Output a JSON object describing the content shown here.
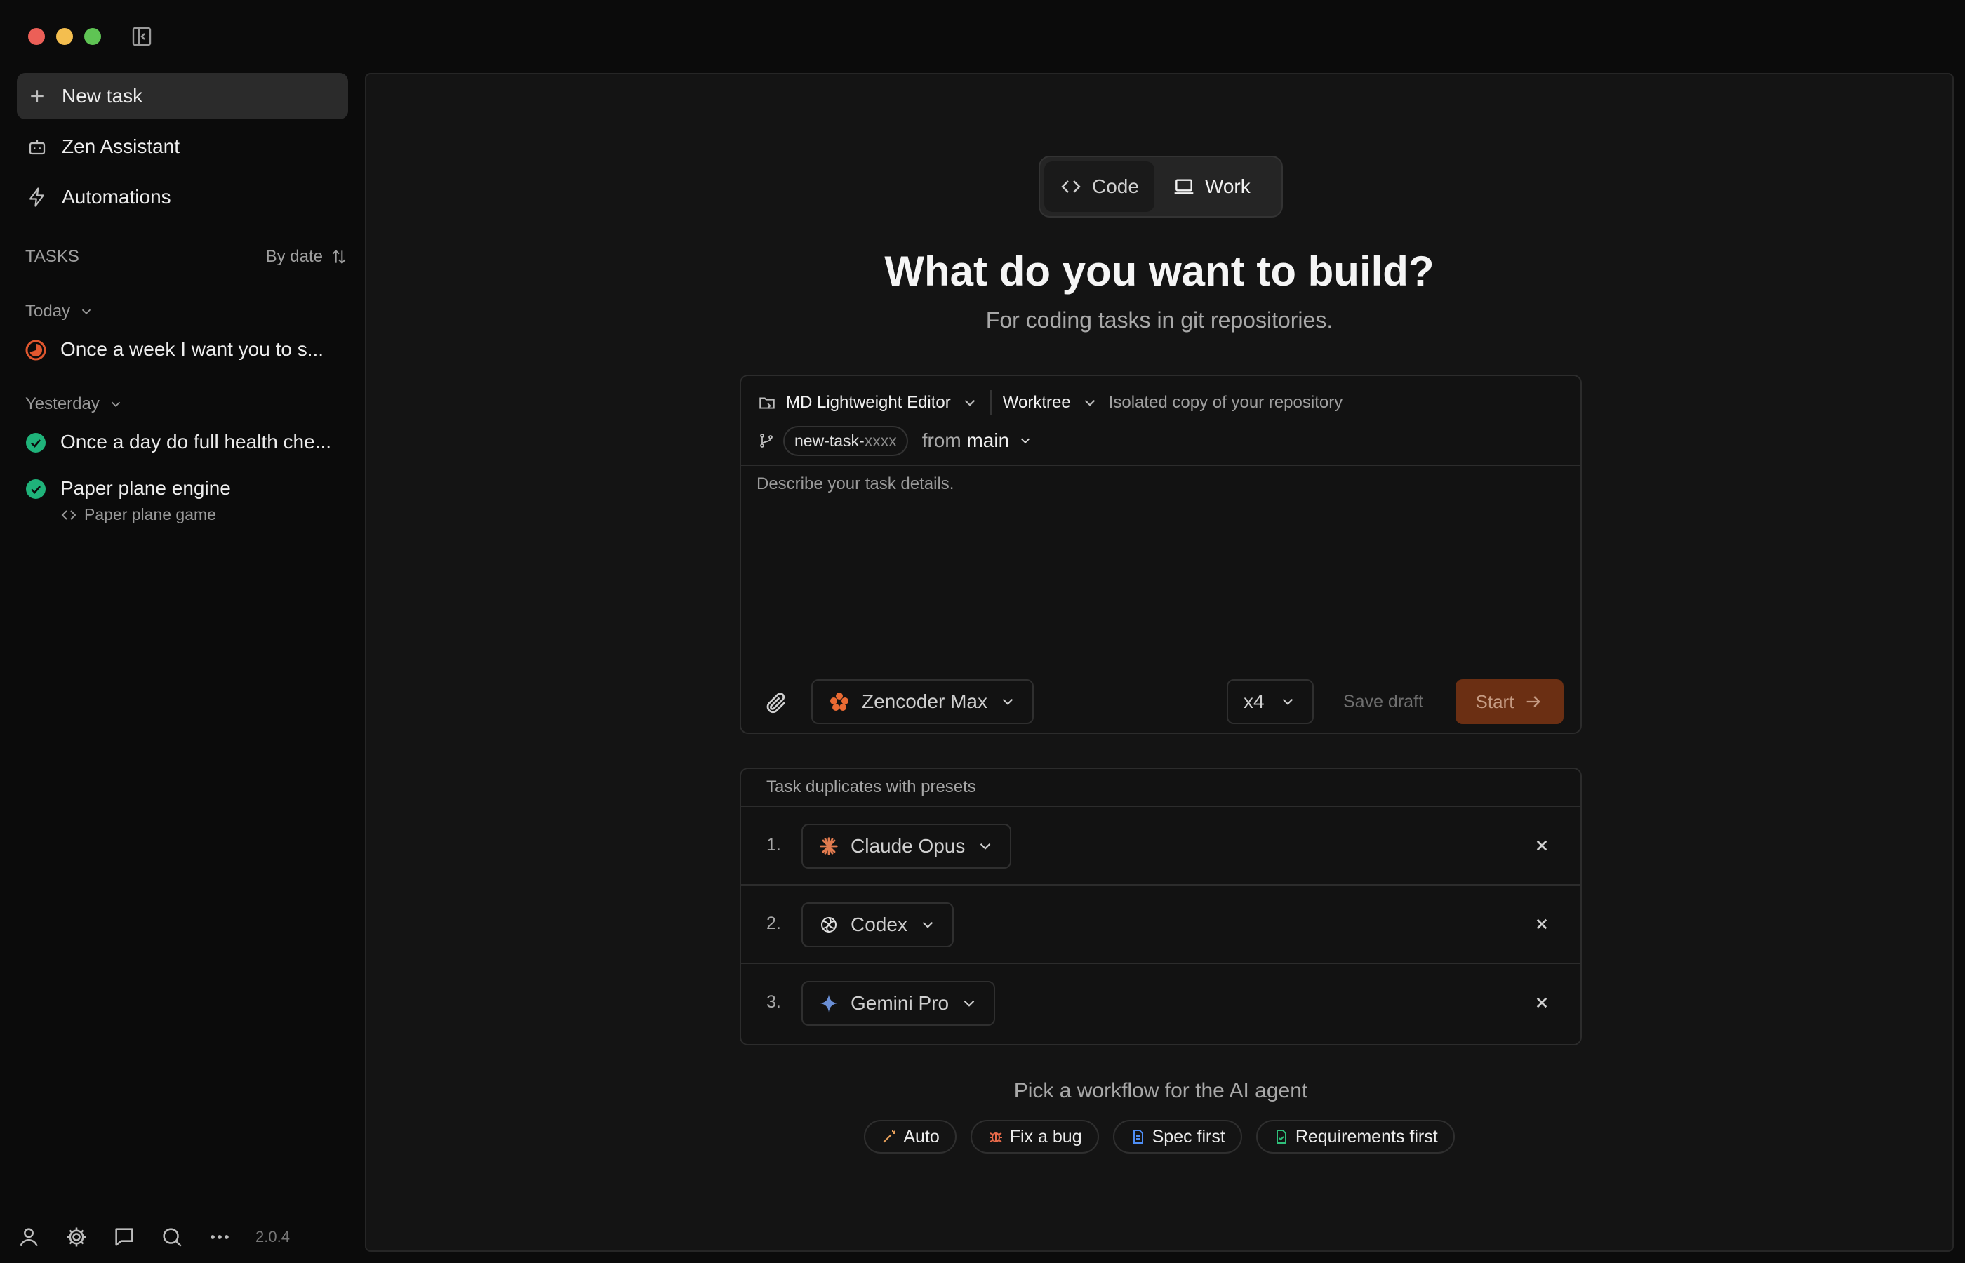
{
  "sidebar": {
    "new_task": "New task",
    "zen_assistant": "Zen Assistant",
    "automations": "Automations",
    "tasks_header": "TASKS",
    "sort_label": "By date",
    "groups": {
      "today": {
        "label": "Today",
        "tasks": [
          {
            "title": "Once a week I want you to s...",
            "status": "in-progress"
          }
        ]
      },
      "yesterday": {
        "label": "Yesterday",
        "tasks": [
          {
            "title": "Once a day do full health che...",
            "status": "done"
          },
          {
            "title": "Paper plane engine",
            "status": "done",
            "subtitle": "Paper plane game"
          }
        ]
      }
    },
    "version": "2.0.4"
  },
  "main": {
    "modes": {
      "code": "Code",
      "work": "Work",
      "selected": "Work"
    },
    "headline": "What do you want to build?",
    "subheadline": "For coding tasks in git repositories.",
    "composer": {
      "repo": "MD Lightweight Editor",
      "env": "Worktree",
      "env_description": "Isolated copy of your repository",
      "branch_prefix": "new-task-",
      "branch_suffix": "xxxx",
      "from_label": "from",
      "base_branch": "main",
      "placeholder": "Describe your task details.",
      "model": "Zencoder Max",
      "multiplier": "x4",
      "save_draft": "Save draft",
      "start": "Start"
    },
    "presets": {
      "title": "Task duplicates with presets",
      "items": [
        {
          "num": "1.",
          "model": "Claude Opus"
        },
        {
          "num": "2.",
          "model": "Codex"
        },
        {
          "num": "3.",
          "model": "Gemini Pro"
        }
      ]
    },
    "workflow": {
      "title": "Pick a workflow for the AI agent",
      "options": [
        "Auto",
        "Fix a bug",
        "Spec first",
        "Requirements first"
      ]
    }
  },
  "colors": {
    "accent_start_bg": "#6b2f13",
    "status_done": "#1fb37a",
    "status_in_progress": "#e0572f",
    "zencoder_logo": "#e96a33",
    "claude_logo": "#e27b4f",
    "gemini_logo": "#6a8fd6"
  }
}
